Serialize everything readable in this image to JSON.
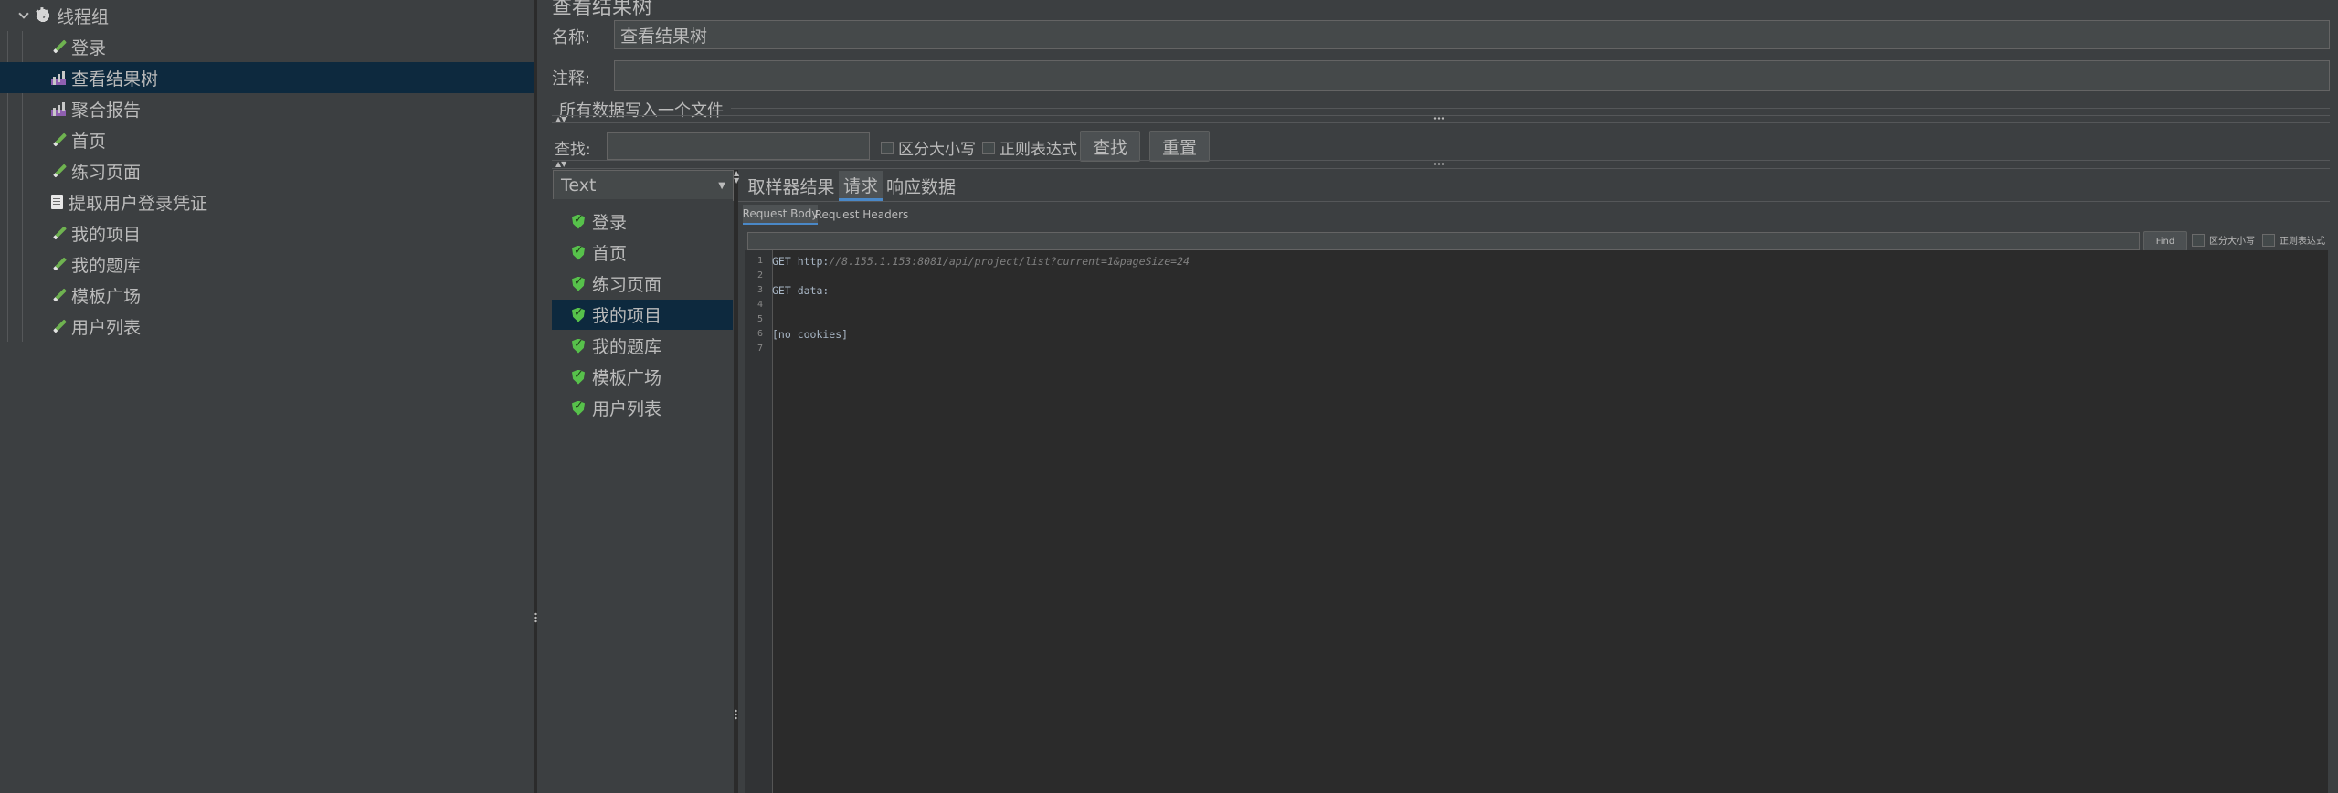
{
  "tree": {
    "root_label": "线程组",
    "items": [
      {
        "label": "登录",
        "icon": "pencil-icon"
      },
      {
        "label": "查看结果树",
        "icon": "chart-icon"
      },
      {
        "label": "聚合报告",
        "icon": "chart-icon"
      },
      {
        "label": "首页",
        "icon": "pencil-icon"
      },
      {
        "label": "练习页面",
        "icon": "pencil-icon"
      },
      {
        "label": "提取用户登录凭证",
        "icon": "doc-icon"
      },
      {
        "label": "我的项目",
        "icon": "pencil-icon"
      },
      {
        "label": "我的题库",
        "icon": "pencil-icon"
      },
      {
        "label": "模板广场",
        "icon": "pencil-icon"
      },
      {
        "label": "用户列表",
        "icon": "pencil-icon"
      }
    ],
    "selected": "查看结果树"
  },
  "panel": {
    "title": "查看结果树",
    "name_label": "名称:",
    "name_value": "查看结果树",
    "comment_label": "注释:",
    "comment_value": "",
    "file_section_label": "所有数据写入一个文件",
    "search_label": "查找:",
    "search_value": "",
    "case_sensitive_label": "区分大小写",
    "regex_label": "正则表达式",
    "find_button": "查找",
    "reset_button": "重置"
  },
  "renderer": {
    "selected": "Text"
  },
  "samplers": {
    "items": [
      "登录",
      "首页",
      "练习页面",
      "我的项目",
      "我的题库",
      "模板广场",
      "用户列表"
    ],
    "selected": "我的项目"
  },
  "result_tabs": [
    "取样器结果",
    "请求",
    "响应数据"
  ],
  "active_tab": "请求",
  "sub_tabs": [
    "Request Body",
    "Request Headers"
  ],
  "active_sub_tab": "Request Body",
  "editor_search": {
    "value": "",
    "find_button": "Find",
    "case_label": "区分大小写",
    "regex_label": "正则表达式"
  },
  "code_lines": [
    {
      "n": "1",
      "prefix": "GET http:",
      "url": "//8.155.1.153:8081/api/project/list?current=1&pageSize=24"
    },
    {
      "n": "2",
      "prefix": "",
      "url": ""
    },
    {
      "n": "3",
      "prefix": "GET data:",
      "url": ""
    },
    {
      "n": "4",
      "prefix": "",
      "url": ""
    },
    {
      "n": "5",
      "prefix": "",
      "url": ""
    },
    {
      "n": "6",
      "prefix": "[no cookies]",
      "url": ""
    },
    {
      "n": "7",
      "prefix": "",
      "url": ""
    }
  ]
}
